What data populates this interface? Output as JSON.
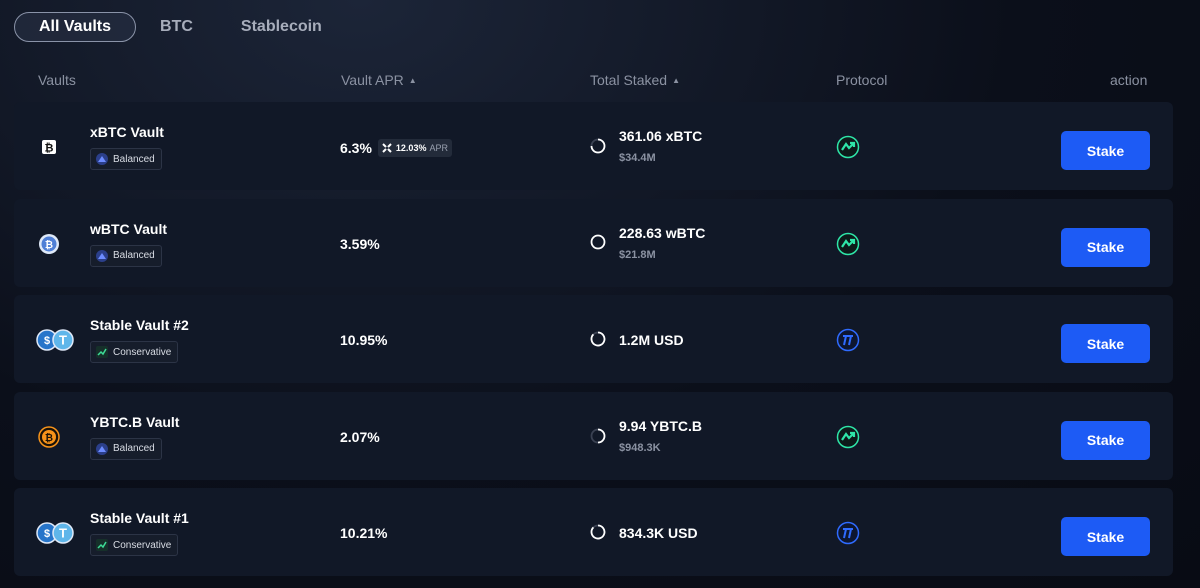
{
  "tabs": [
    {
      "label": "All Vaults",
      "active": true
    },
    {
      "label": "BTC",
      "active": false
    },
    {
      "label": "Stablecoin",
      "active": false
    }
  ],
  "table": {
    "columns": {
      "vaults": "Vaults",
      "apr": "Vault APR",
      "staked": "Total Staked",
      "protocol": "Protocol",
      "action": "action"
    },
    "rows": [
      {
        "name": "xBTC Vault",
        "icon": "xbtc-icon",
        "risk": "Balanced",
        "apr": "6.3%",
        "boost_value": "12.03%",
        "boost_suffix": "APR",
        "staked": "361.06 xBTC",
        "staked_usd": "$34.4M",
        "protocol_icon": "lending-protocol-icon",
        "action": "Stake"
      },
      {
        "name": "wBTC Vault",
        "icon": "wbtc-icon",
        "risk": "Balanced",
        "apr": "3.59%",
        "staked": "228.63 wBTC",
        "staked_usd": "$21.8M",
        "protocol_icon": "lending-protocol-icon",
        "action": "Stake"
      },
      {
        "name": "Stable Vault #2",
        "icon": "usdc-usdt-icon",
        "risk": "Conservative",
        "apr": "10.95%",
        "staked": "1.2M USD",
        "protocol_icon": "stable-protocol-icon",
        "action": "Stake"
      },
      {
        "name": "YBTC.B Vault",
        "icon": "ybtc-icon",
        "risk": "Balanced",
        "apr": "2.07%",
        "staked": "9.94 YBTC.B",
        "staked_usd": "$948.3K",
        "protocol_icon": "lending-protocol-icon",
        "action": "Stake"
      },
      {
        "name": "Stable Vault #1",
        "icon": "usdc-usdt-icon",
        "risk": "Conservative",
        "apr": "10.21%",
        "staked": "834.3K USD",
        "protocol_icon": "stable-protocol-icon",
        "action": "Stake"
      }
    ]
  },
  "colors": {
    "accent": "#1d5bf5",
    "row_bg": "#111827",
    "muted_text": "#8b92a2",
    "protocol_green": "#2ee6a8",
    "protocol_blue": "#2f6bff"
  }
}
